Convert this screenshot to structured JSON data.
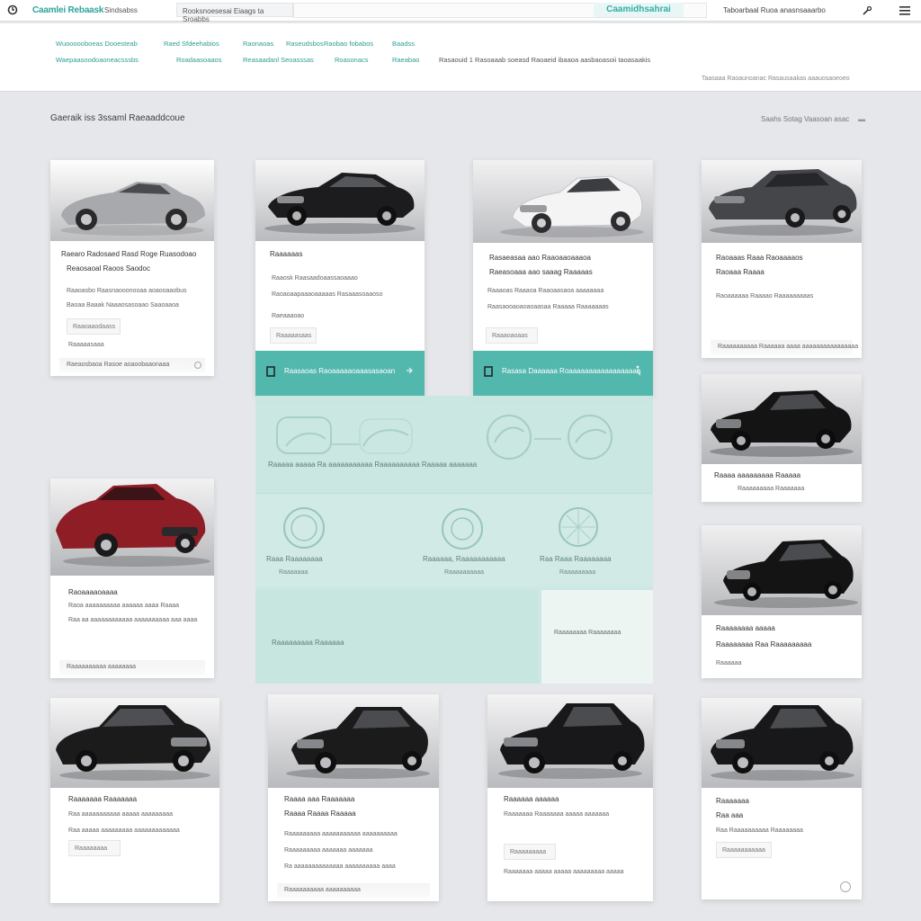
{
  "topbar": {
    "brand": "Caamlei Rebaask",
    "brand_sub": "Sindsabss",
    "breadcrumb": "Rooksnoesesai Eiaags ta Sroabbs",
    "search_button": "Caamidhsahrai",
    "account": "Taboarbaal Ruoa anasnsaaarbo"
  },
  "nav": {
    "row1": [
      "Wuoooooboeas Dooesteab",
      "Raed Sfdeehabios",
      "Raonaoas",
      "Raseudsbos",
      "Raobao fobabos",
      "Baadss"
    ],
    "row2": [
      "Waepaasoodoaoneacsssbs",
      "Roadaasoaaos",
      "Reasaadanl Seoasssas",
      "Roasonacs",
      "Raeabao"
    ],
    "notice": "Rasaouid 1 Rasoaaab soeasd Raoaeid ibaaoa aasbaoasoii taoasaakis",
    "meta": "Taasaaa Raoaunoanac Rasausaakas aaauosaoeoeo"
  },
  "page": {
    "heading": "Gaeraik iss 3ssaml Raeaaddcoue",
    "sort": "Saahs Sotag Vaasoan asac"
  },
  "cards": [
    {
      "id": "c1",
      "lines": [
        "Raearo Radosaed Rasd Roge Ruasodoao",
        "Reaosaoal Raoos Saodoc"
      ],
      "detail": "Raaoasbo Raasnaooonooaa aoaooaaobus",
      "detail2": "Baoaa Baaak Naaaosasoaao Saaoaaoa",
      "button": "Raaoaaodaass",
      "small": "Raaaaasaaa",
      "foot": "Raeaosbaoa Rasoe aoaoobaaonaaa"
    },
    {
      "id": "c2",
      "lines": [
        "Raaaaaas"
      ],
      "detail": "Raaosk Raasaadoaassaoaaao",
      "detail2": "Raoaoaapaaaoaaaaas Rasaaasoaaoso",
      "button": "Raaaaasaas",
      "small": "Raeaaaoao",
      "bar": "Raasaoas Raoaaaaaoaaasasaoan"
    },
    {
      "id": "c3",
      "lines": [
        "Rasaeasaa aao Raaoaaoaaaoa",
        "Raeasoaaa aao saaag Raaaaas"
      ],
      "detail": "Raaaoas Raaaoa Raaoaasaoa aaaaaaaa",
      "detail2": "Raasaooaoaoaoaasaa Raaaaa Raaaaaaas",
      "button": "Raaaoaoaas",
      "bar": "Rasasa Daaaaaa Roaaaaaaaaaaaaaaaaaa"
    },
    {
      "id": "c4",
      "lines": [
        "Raoaaas Raaa Raoaaaaos",
        "Raoaaa Raaaa"
      ],
      "detail": "Raoaaaaaa Raaaao Raaaaaaaaas",
      "foot": "Raaaaaaaaaa Raaaaaa aaaa aaaaaaaaaaaaaaaa"
    },
    {
      "id": "c5",
      "lines": [
        "Raoaaaaoaaaa",
        "Raoa aaaaaaaaaa aaaaaa aaaa Raaaa",
        "Raa aa aaaaaaaaaaaa aaaaaaaaaa aaa aaaa"
      ],
      "foot": "Raaaaaaaaaa aaaaaaaa"
    },
    {
      "id": "c6",
      "lines": [
        "Raaaa aaaaaaaaa Raaaaa",
        "Raaaaaaaaa Raaaaaaa"
      ]
    },
    {
      "id": "c7",
      "lines": [
        "Raaaaaaaa aaaaa",
        "Raaaaaaaa Raa Raaaaaaaaa"
      ],
      "small": "Raaaaaa"
    },
    {
      "id": "c8",
      "lines": [
        "Raaaaaaa Raaaaaaa",
        "Raa aaaaaaaaaaa aaaaa aaaaaaaaa",
        "Raa aaaaa aaaaaaaaa aaaaaaaaaaaaa"
      ],
      "button": "Raaaaaaaa"
    },
    {
      "id": "c9",
      "lines": [
        "Raaaa aaa Raaaaaaa",
        "Raaaa Raaaa Raaaaa",
        "Raaaaaaaaa aaaaaaaaaaa aaaaaaaaaa",
        "Raaaaaaaaa aaaaaaa aaaaaaa",
        "Ra aaaaaaaaaaaaaa aaaaaaaaaa aaaa"
      ],
      "foot": "Raaaaaaaaaa aaaaaaaaaa"
    },
    {
      "id": "c10",
      "lines": [
        "Raaaaaa aaaaaa",
        "Raaaaaaa Raaaaaaa aaaaa aaaaaaa"
      ],
      "button": "Raaaaaaaaa",
      "detail2": "Raaaaaaa aaaaa aaaaa aaaaaaaaa aaaaa"
    },
    {
      "id": "c11",
      "lines": [
        "Raaaaaaa",
        "Raa aaa",
        "Raa Raaaaaaaaaa Raaaaaaaa"
      ],
      "button": "Raaaaaaaaaaa"
    }
  ],
  "feature": {
    "caption": "Raaaaa aaaaa Ra aaaaaaaaaaa Raaaaaaaaaa Raaaaa aaaaaaa",
    "items": [
      {
        "title": "Raaa Raaaaaaaa",
        "sub": "Raaaaaaa"
      },
      {
        "title": "Raaaaaa, Raaaaaaaaaaa",
        "sub": "Raaaaaaaaaa"
      },
      {
        "title": "Raa Raaa Raaaaaaaa",
        "sub": "Raaaaaaaaa"
      }
    ],
    "cta": "Raaaaaaaaa Raaaaaa",
    "side": "Raaaaaaaa Raaaaaaaa"
  },
  "colors": {
    "accent": "#52b7ad",
    "accent_text": "#2d9e95",
    "page_bg": "#e6e7ea"
  },
  "icons": [
    "logo-icon",
    "wrench-icon",
    "hamburger-menu-icon",
    "bookmark-icon",
    "accessibility-icon",
    "car-image"
  ]
}
